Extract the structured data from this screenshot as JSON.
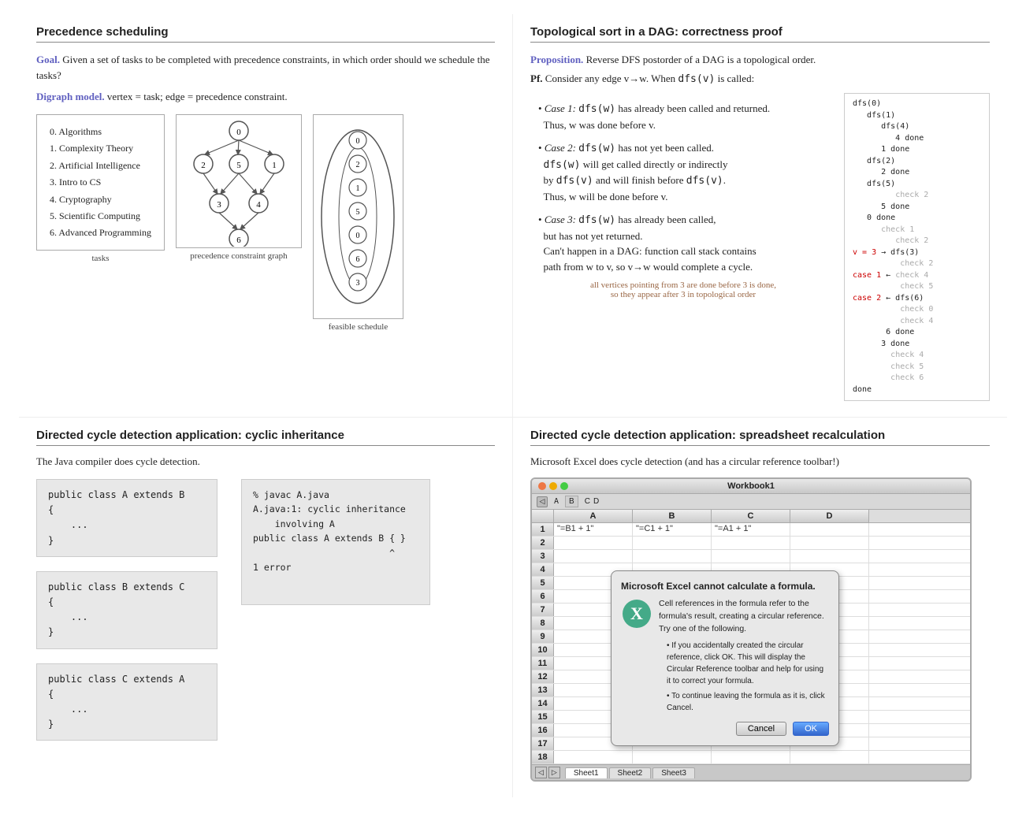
{
  "panels": {
    "top_left": {
      "title": "Precedence scheduling",
      "goal_label": "Goal.",
      "goal_text": " Given a set of tasks to be completed with precedence constraints, in which order should we schedule the tasks?",
      "digraph_label": "Digraph model.",
      "digraph_text": " vertex = task; edge = precedence constraint.",
      "tasks": [
        "0.  Algorithms",
        "1.  Complexity Theory",
        "2.  Artificial Intelligence",
        "3.  Intro to CS",
        "4.  Cryptography",
        "5.  Scientific Computing",
        "6.  Advanced Programming"
      ],
      "label_tasks": "tasks",
      "label_precedence": "precedence constraint graph",
      "label_schedule": "feasible schedule"
    },
    "top_right": {
      "title": "Topological sort in a DAG:  correctness proof",
      "prop_label": "Proposition.",
      "prop_text": "  Reverse DFS postorder of a DAG is a topological order.",
      "pf_label": "Pf.",
      "pf_text": "  Consider any edge v→w. When dfs(v) is called:",
      "cases": [
        {
          "label": "Case 1:",
          "text": " dfs(w) has already been called and returned.\n Thus, w was done before v."
        },
        {
          "label": "Case 2:",
          "text": " dfs(w) has not yet been called.\n dfs(w) will get called directly or indirectly\n by dfs(v) and will finish before dfs(v).\n Thus, w will be done before v."
        },
        {
          "label": "Case 3:",
          "text": " dfs(w) has already been called,\n but has not yet returned.\n Can't happen in a DAG: function call stack contains\n path from w to v, so v→w would complete a cycle."
        }
      ],
      "bottom_note": "all vertices pointing from 3 are done before 3 is done,\nso they appear after 3 in topological order",
      "diagram": [
        "dfs(0)",
        "   dfs(1)",
        "      dfs(4)",
        "         4 done",
        "      1 done",
        "   dfs(2)",
        "      2 done",
        "   dfs(5)",
        "         check 2",
        "      5 done",
        "   0 done",
        "      check 1",
        "         check 2",
        "v = 3  →   dfs(3)",
        "              check 2",
        "case 1 ←   check 4",
        "              check 5",
        "case 2 ←   dfs(6)",
        "              check 0",
        "              check 4",
        "         6 done",
        "      3 done",
        "         check 4",
        "         check 5",
        "         check 6",
        "   done"
      ]
    },
    "bottom_left": {
      "title": "Directed cycle detection application:  cyclic inheritance",
      "intro": "The Java compiler does cycle detection.",
      "code_blocks": [
        "public class A extends B\n{\n    ...\n}",
        "public class B extends C\n{\n    ...\n}",
        "public class C extends A\n{\n    ...\n}"
      ],
      "compiler_output": "% javac A.java\nA.java:1: cyclic inheritance\n    involving A\npublic class A extends B { }\n                         ^\n1 error"
    },
    "bottom_right": {
      "title": "Directed cycle detection application:  spreadsheet recalculation",
      "intro": "Microsoft Excel does cycle detection (and has a circular reference toolbar!)",
      "workbook_title": "Workbook1",
      "columns": [
        "",
        "A",
        "B",
        "C",
        "D"
      ],
      "rows": [
        [
          "1",
          "\"=B1 + 1\"",
          "\"=C1 + 1\"",
          "\"=A1 + 1\"",
          ""
        ],
        [
          "2",
          "",
          "",
          "",
          ""
        ],
        [
          "3",
          "",
          "",
          "",
          ""
        ],
        [
          "4",
          "",
          "",
          "",
          ""
        ],
        [
          "5",
          "",
          "",
          "",
          ""
        ],
        [
          "6",
          "",
          "",
          "",
          ""
        ],
        [
          "7",
          "",
          "",
          "",
          ""
        ],
        [
          "8",
          "",
          "",
          "",
          ""
        ],
        [
          "9",
          "",
          "",
          "",
          ""
        ],
        [
          "10",
          "",
          "",
          "",
          ""
        ],
        [
          "11",
          "",
          "",
          "",
          ""
        ],
        [
          "12",
          "",
          "",
          "",
          ""
        ],
        [
          "13",
          "",
          "",
          "",
          ""
        ],
        [
          "14",
          "",
          "",
          "",
          ""
        ],
        [
          "15",
          "",
          "",
          "",
          ""
        ],
        [
          "16",
          "",
          "",
          "",
          ""
        ],
        [
          "17",
          "",
          "",
          "",
          ""
        ],
        [
          "18",
          "",
          "",
          "",
          ""
        ]
      ],
      "dialog": {
        "title": "Microsoft Excel cannot calculate a formula.",
        "body": "Cell references in the formula refer to the formula's result, creating a circular reference. Try one of the following.",
        "bullets": [
          "If you accidentally created the circular reference, click OK. This will display the Circular Reference toolbar and help for using it to correct your formula.",
          "To continue leaving the formula as it is, click Cancel."
        ],
        "cancel_label": "Cancel",
        "ok_label": "OK"
      },
      "tabs": [
        "Sheet1",
        "Sheet2",
        "Sheet3"
      ]
    }
  }
}
